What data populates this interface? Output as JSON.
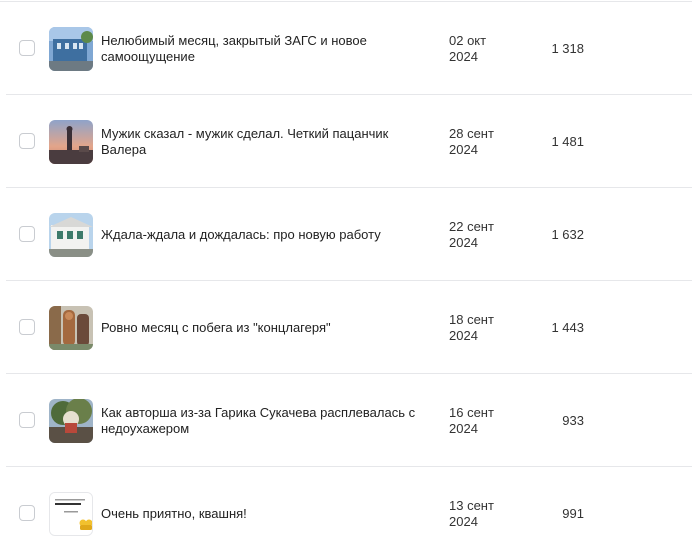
{
  "articles": [
    {
      "title": "Нелюбимый месяц, закрытый ЗАГС и новое самоощущение",
      "date": "02 окт\n2024",
      "views": "1 318",
      "thumb_icon": "building-photo-icon"
    },
    {
      "title": "Мужик сказал - мужик сделал. Четкий пацанчик Валера",
      "date": "28 сент\n2024",
      "views": "1 481",
      "thumb_icon": "sunset-monument-photo-icon"
    },
    {
      "title": "Ждала-ждала и дождалась: про новую работу",
      "date": "22 сент\n2024",
      "views": "1 632",
      "thumb_icon": "white-house-photo-icon"
    },
    {
      "title": "Ровно месяц с побега из \"концлагеря\"",
      "date": "18 сент\n2024",
      "views": "1 443",
      "thumb_icon": "wooden-sculpture-photo-icon"
    },
    {
      "title": "Как авторша из-за Гарика Сукачева расплевалась с недоухажером",
      "date": "16 сент\n2024",
      "views": "933",
      "thumb_icon": "tree-garden-photo-icon"
    },
    {
      "title": "Очень приятно, квашня!",
      "date": "13 сент\n2024",
      "views": "991",
      "thumb_icon": "text-card-thumbs-up-icon"
    }
  ]
}
